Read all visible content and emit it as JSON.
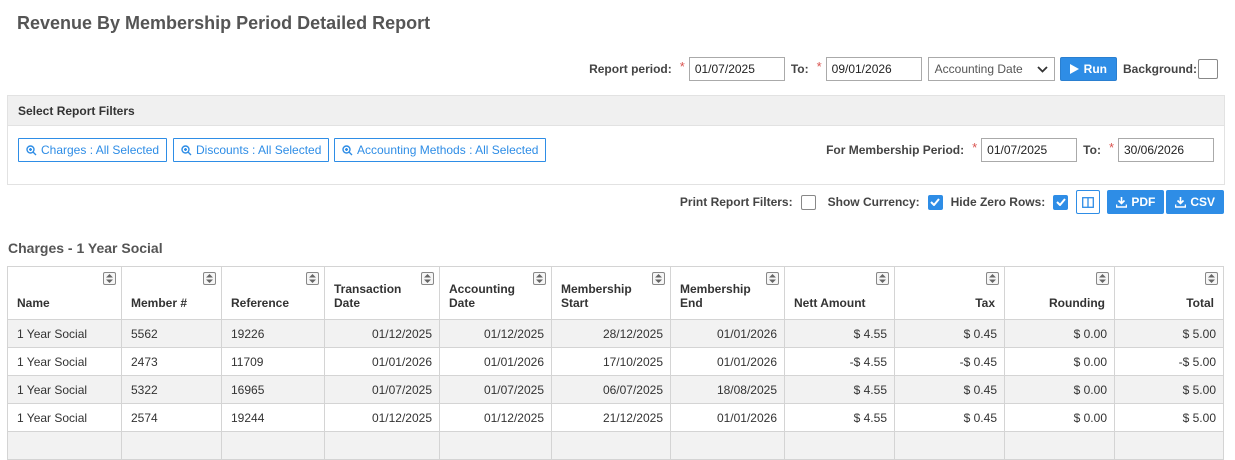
{
  "page_title": "Revenue By Membership Period Detailed Report",
  "report_period": {
    "label": "Report period:",
    "from": "01/07/2025",
    "to_label": "To:",
    "to": "09/01/2026",
    "date_type": "Accounting Date",
    "run_label": "Run",
    "background_label": "Background:"
  },
  "filters": {
    "header": "Select Report Filters",
    "charges_btn": "Charges : All Selected",
    "discounts_btn": "Discounts : All Selected",
    "accounting_btn": "Accounting Methods : All Selected",
    "membership_period_label": "For Membership Period:",
    "mp_from": "01/07/2025",
    "mp_to_label": "To:",
    "mp_to": "30/06/2026"
  },
  "options": {
    "print_filters_label": "Print Report Filters:",
    "show_currency_label": "Show Currency:",
    "hide_zero_label": "Hide Zero Rows:",
    "pdf_label": "PDF",
    "csv_label": "CSV"
  },
  "section_title": "Charges - 1 Year Social",
  "table": {
    "columns": [
      "Name",
      "Member #",
      "Reference",
      "Transaction Date",
      "Accounting Date",
      "Membership Start",
      "Membership End",
      "Nett Amount",
      "Tax",
      "Rounding",
      "Total"
    ],
    "rows": [
      [
        "1 Year Social",
        "5562",
        "19226",
        "01/12/2025",
        "01/12/2025",
        "28/12/2025",
        "01/01/2026",
        "$ 4.55",
        "$ 0.45",
        "$ 0.00",
        "$ 5.00"
      ],
      [
        "1 Year Social",
        "2473",
        "11709",
        "01/01/2026",
        "01/01/2026",
        "17/10/2025",
        "01/01/2026",
        "-$ 4.55",
        "-$ 0.45",
        "$ 0.00",
        "-$ 5.00"
      ],
      [
        "1 Year Social",
        "5322",
        "16965",
        "01/07/2025",
        "01/07/2025",
        "06/07/2025",
        "18/08/2025",
        "$ 4.55",
        "$ 0.45",
        "$ 0.00",
        "$ 5.00"
      ],
      [
        "1 Year Social",
        "2574",
        "19244",
        "01/12/2025",
        "01/12/2025",
        "21/12/2025",
        "01/01/2026",
        "$ 4.55",
        "$ 0.45",
        "$ 0.00",
        "$ 5.00"
      ]
    ]
  },
  "colors": {
    "accent": "#2e8de6",
    "required": "#d9534f",
    "stripe": "#f2f2f2"
  }
}
